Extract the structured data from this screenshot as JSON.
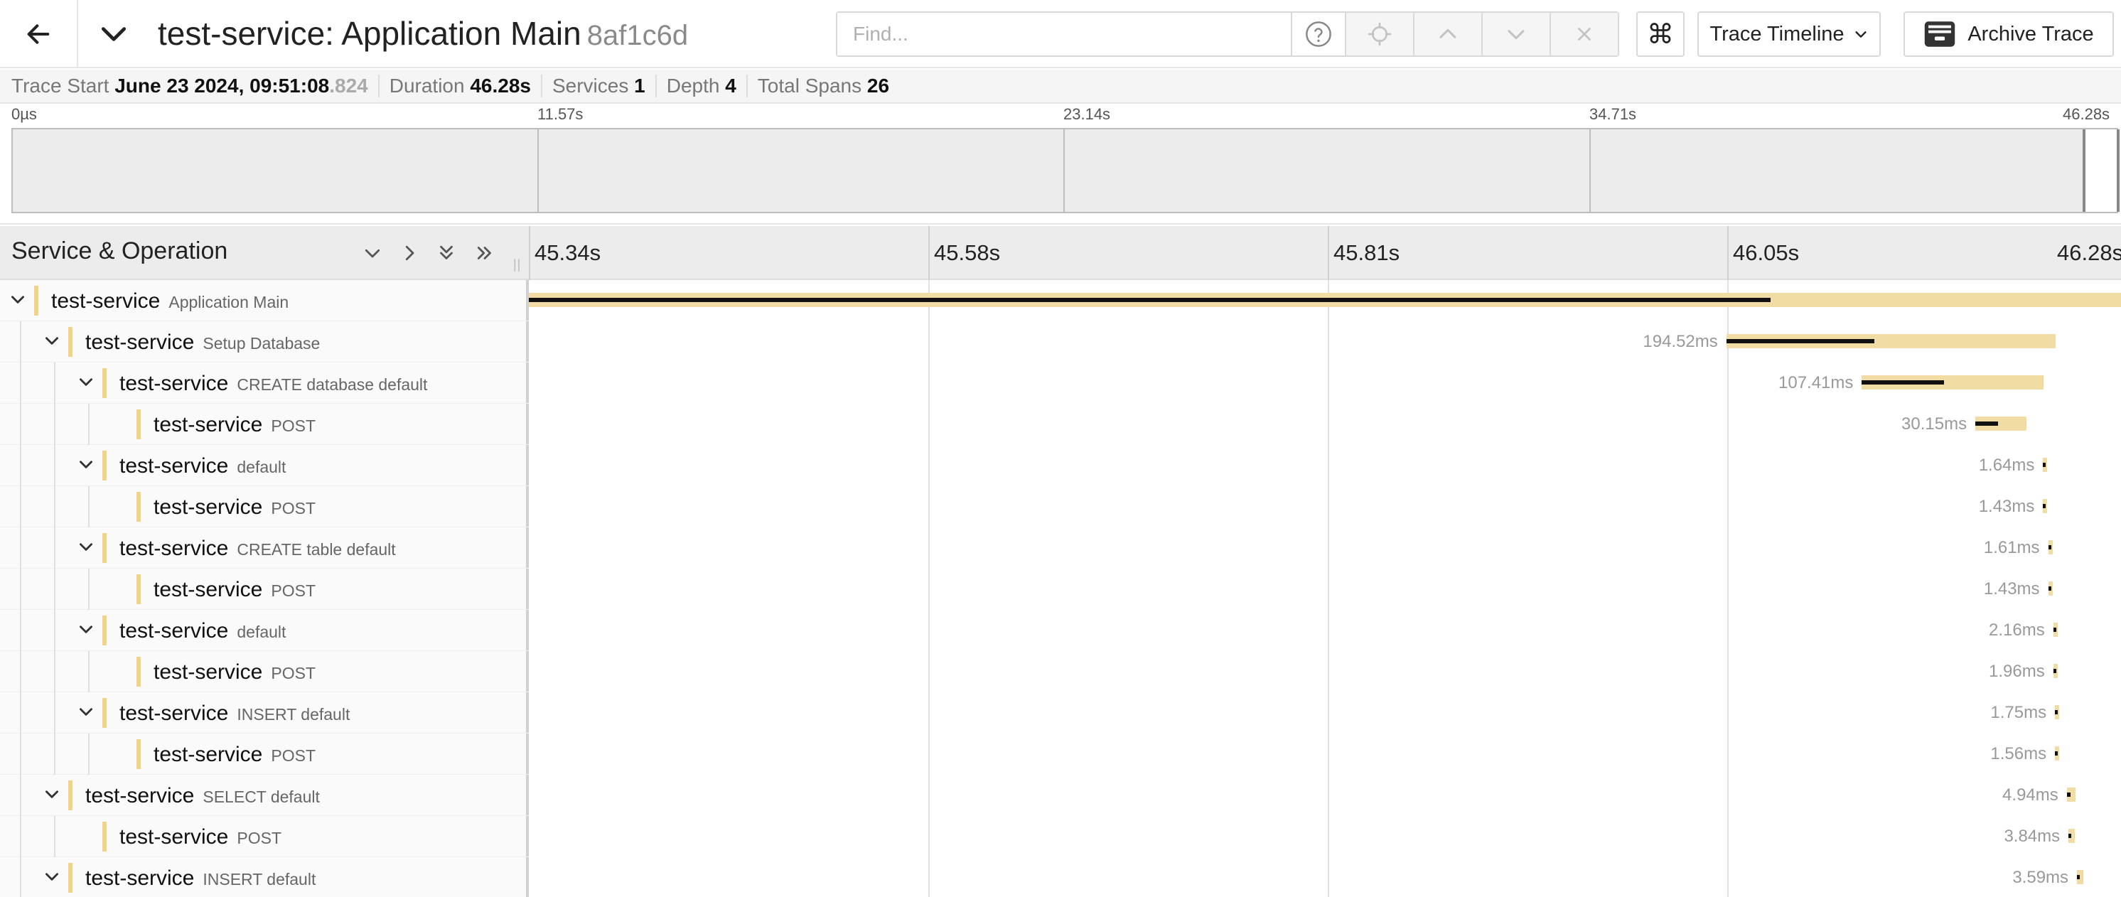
{
  "header": {
    "title": "test-service: Application Main",
    "trace_id": "8af1c6d",
    "find_placeholder": "Find...",
    "view_label": "Trace Timeline",
    "archive_label": "Archive Trace",
    "keyboard_glyph": "⌘"
  },
  "summary": {
    "trace_start_label": "Trace Start",
    "trace_start_value": "June 23 2024, 09:51:08",
    "trace_start_ms": ".824",
    "duration_label": "Duration",
    "duration_value": "46.28s",
    "services_label": "Services",
    "services_value": "1",
    "depth_label": "Depth",
    "depth_value": "4",
    "total_spans_label": "Total Spans",
    "total_spans_value": "26"
  },
  "minimap": {
    "ticks": [
      "0µs",
      "11.57s",
      "23.14s",
      "34.71s",
      "46.28s"
    ]
  },
  "timeline": {
    "column_title": "Service & Operation",
    "ticks": [
      "45.34s",
      "45.58s",
      "45.81s",
      "46.05s",
      "46.28s"
    ],
    "view_range_s": [
      45.34,
      46.28
    ]
  },
  "spans": [
    {
      "service": "test-service",
      "operation": "Application Main",
      "depth": 0,
      "has_children": true,
      "start_s": 0.0,
      "duration_ms": 46280.0,
      "duration": ""
    },
    {
      "service": "test-service",
      "operation": "Setup Database",
      "depth": 1,
      "has_children": true,
      "start_s": 46.047,
      "duration_ms": 194.52,
      "duration": "194.52ms"
    },
    {
      "service": "test-service",
      "operation": "CREATE database default",
      "depth": 2,
      "has_children": true,
      "start_s": 46.127,
      "duration_ms": 107.41,
      "duration": "107.41ms"
    },
    {
      "service": "test-service",
      "operation": "POST",
      "depth": 3,
      "has_children": false,
      "start_s": 46.194,
      "duration_ms": 30.15,
      "duration": "30.15ms"
    },
    {
      "service": "test-service",
      "operation": "default",
      "depth": 2,
      "has_children": true,
      "start_s": 46.234,
      "duration_ms": 1.64,
      "duration": "1.64ms"
    },
    {
      "service": "test-service",
      "operation": "POST",
      "depth": 3,
      "has_children": false,
      "start_s": 46.234,
      "duration_ms": 1.43,
      "duration": "1.43ms"
    },
    {
      "service": "test-service",
      "operation": "CREATE table default",
      "depth": 2,
      "has_children": true,
      "start_s": 46.237,
      "duration_ms": 1.61,
      "duration": "1.61ms"
    },
    {
      "service": "test-service",
      "operation": "POST",
      "depth": 3,
      "has_children": false,
      "start_s": 46.237,
      "duration_ms": 1.43,
      "duration": "1.43ms"
    },
    {
      "service": "test-service",
      "operation": "default",
      "depth": 2,
      "has_children": true,
      "start_s": 46.24,
      "duration_ms": 2.16,
      "duration": "2.16ms"
    },
    {
      "service": "test-service",
      "operation": "POST",
      "depth": 3,
      "has_children": false,
      "start_s": 46.24,
      "duration_ms": 1.96,
      "duration": "1.96ms"
    },
    {
      "service": "test-service",
      "operation": "INSERT default",
      "depth": 2,
      "has_children": true,
      "start_s": 46.241,
      "duration_ms": 1.75,
      "duration": "1.75ms"
    },
    {
      "service": "test-service",
      "operation": "POST",
      "depth": 3,
      "has_children": false,
      "start_s": 46.241,
      "duration_ms": 1.56,
      "duration": "1.56ms"
    },
    {
      "service": "test-service",
      "operation": "SELECT default",
      "depth": 1,
      "has_children": true,
      "start_s": 46.248,
      "duration_ms": 4.94,
      "duration": "4.94ms"
    },
    {
      "service": "test-service",
      "operation": "POST",
      "depth": 2,
      "has_children": false,
      "start_s": 46.249,
      "duration_ms": 3.84,
      "duration": "3.84ms"
    },
    {
      "service": "test-service",
      "operation": "INSERT default",
      "depth": 1,
      "has_children": true,
      "start_s": 46.254,
      "duration_ms": 3.59,
      "duration": "3.59ms"
    }
  ],
  "colors": {
    "span_track": "#f1dca4",
    "span_self": "#111111",
    "service_color": "#f0d48a"
  }
}
